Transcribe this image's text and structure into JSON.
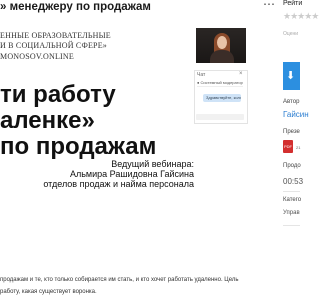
{
  "header": {
    "title": "» менеджеру по продажам"
  },
  "slide": {
    "org_lines": [
      "ЕННЫЕ ОБРАЗОВАТЕЛЬНЫЕ",
      "И В СОЦИАЛЬНОЙ СФЕРЕ»",
      "MONOSOV.ONLINE"
    ],
    "headline_lines": [
      "ти работу",
      "аленке»",
      "по продажам"
    ],
    "presenter_lines": [
      "Ведущий вебинара:",
      "Альмира Рашидовна Гайсина",
      "отделов продаж и найма персонала"
    ]
  },
  "chat": {
    "label": "Чат",
    "close": "×",
    "line1": "● Системный модератор",
    "message": "Здравствуйте, коллеги"
  },
  "sidebar": {
    "rating_label": "Рейти",
    "stars": "★★★★★",
    "sub_label": "Оцени",
    "download_icon": "download-icon",
    "author_label": "Автор",
    "author_name": "Гайсин",
    "presentation_label": "Презе",
    "pdf_label": "PDF",
    "pdf_count": "21",
    "duration_label": "Продо",
    "duration_value": "00:53",
    "category_label": "Катего",
    "category_value": "Управ"
  },
  "description": {
    "line1": "продажам и те, кто только собирается им стать, и кто хочет работать удаленно. Цель",
    "line2": "работу, какая существует воронка."
  },
  "colors": {
    "accent": "#2c8fe0",
    "link": "#2a7dd1",
    "pdf": "#d32f2f"
  }
}
